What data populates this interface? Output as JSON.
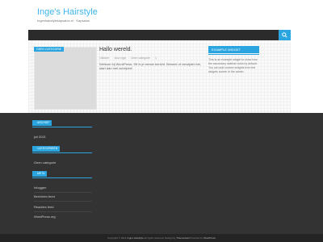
{
  "site": {
    "title": "Inge's Hairstyle",
    "description": "Ingeshairstylekapsalon.nl · Kapsalon"
  },
  "post": {
    "category_tag": "Geen categorie",
    "title": "Hallo wereld.",
    "date": "Oktober",
    "author": "door inge",
    "category": "Geen categorie",
    "comments": "1",
    "excerpt": "Welkom bij WordPress. Dit is je eerste bericht. Bewerk of verwijder het, start dan met schrijven!"
  },
  "sidebar": {
    "widget_title": "Example Widget",
    "widget_text": "This is an example widget to show how the secondary sidebar looks by default. You can add custom widgets from the widgets screen in the admin."
  },
  "footer": {
    "archives_title": "Archief",
    "archives": [
      "juli 2021"
    ],
    "categories_title": "Categorieën",
    "categories": [
      "Geen categorie"
    ],
    "meta_title": "Meta",
    "meta": [
      "Inloggen",
      "Berichten feed",
      "Reacties feed",
      "WordPress.org"
    ]
  },
  "bottom": {
    "copyright": "Copyright © 2021",
    "site_name": "Inge's Hairstyle",
    "rights": "All rights reserved. Design by",
    "theme": "ThemeHunk",
    "powered": "Powered by",
    "platform": "WordPress"
  },
  "colors": {
    "accent": "#2aa5df",
    "title": "#3fb5eb",
    "footer_bg": "#333333",
    "nav_bg": "#2b2b2b"
  }
}
